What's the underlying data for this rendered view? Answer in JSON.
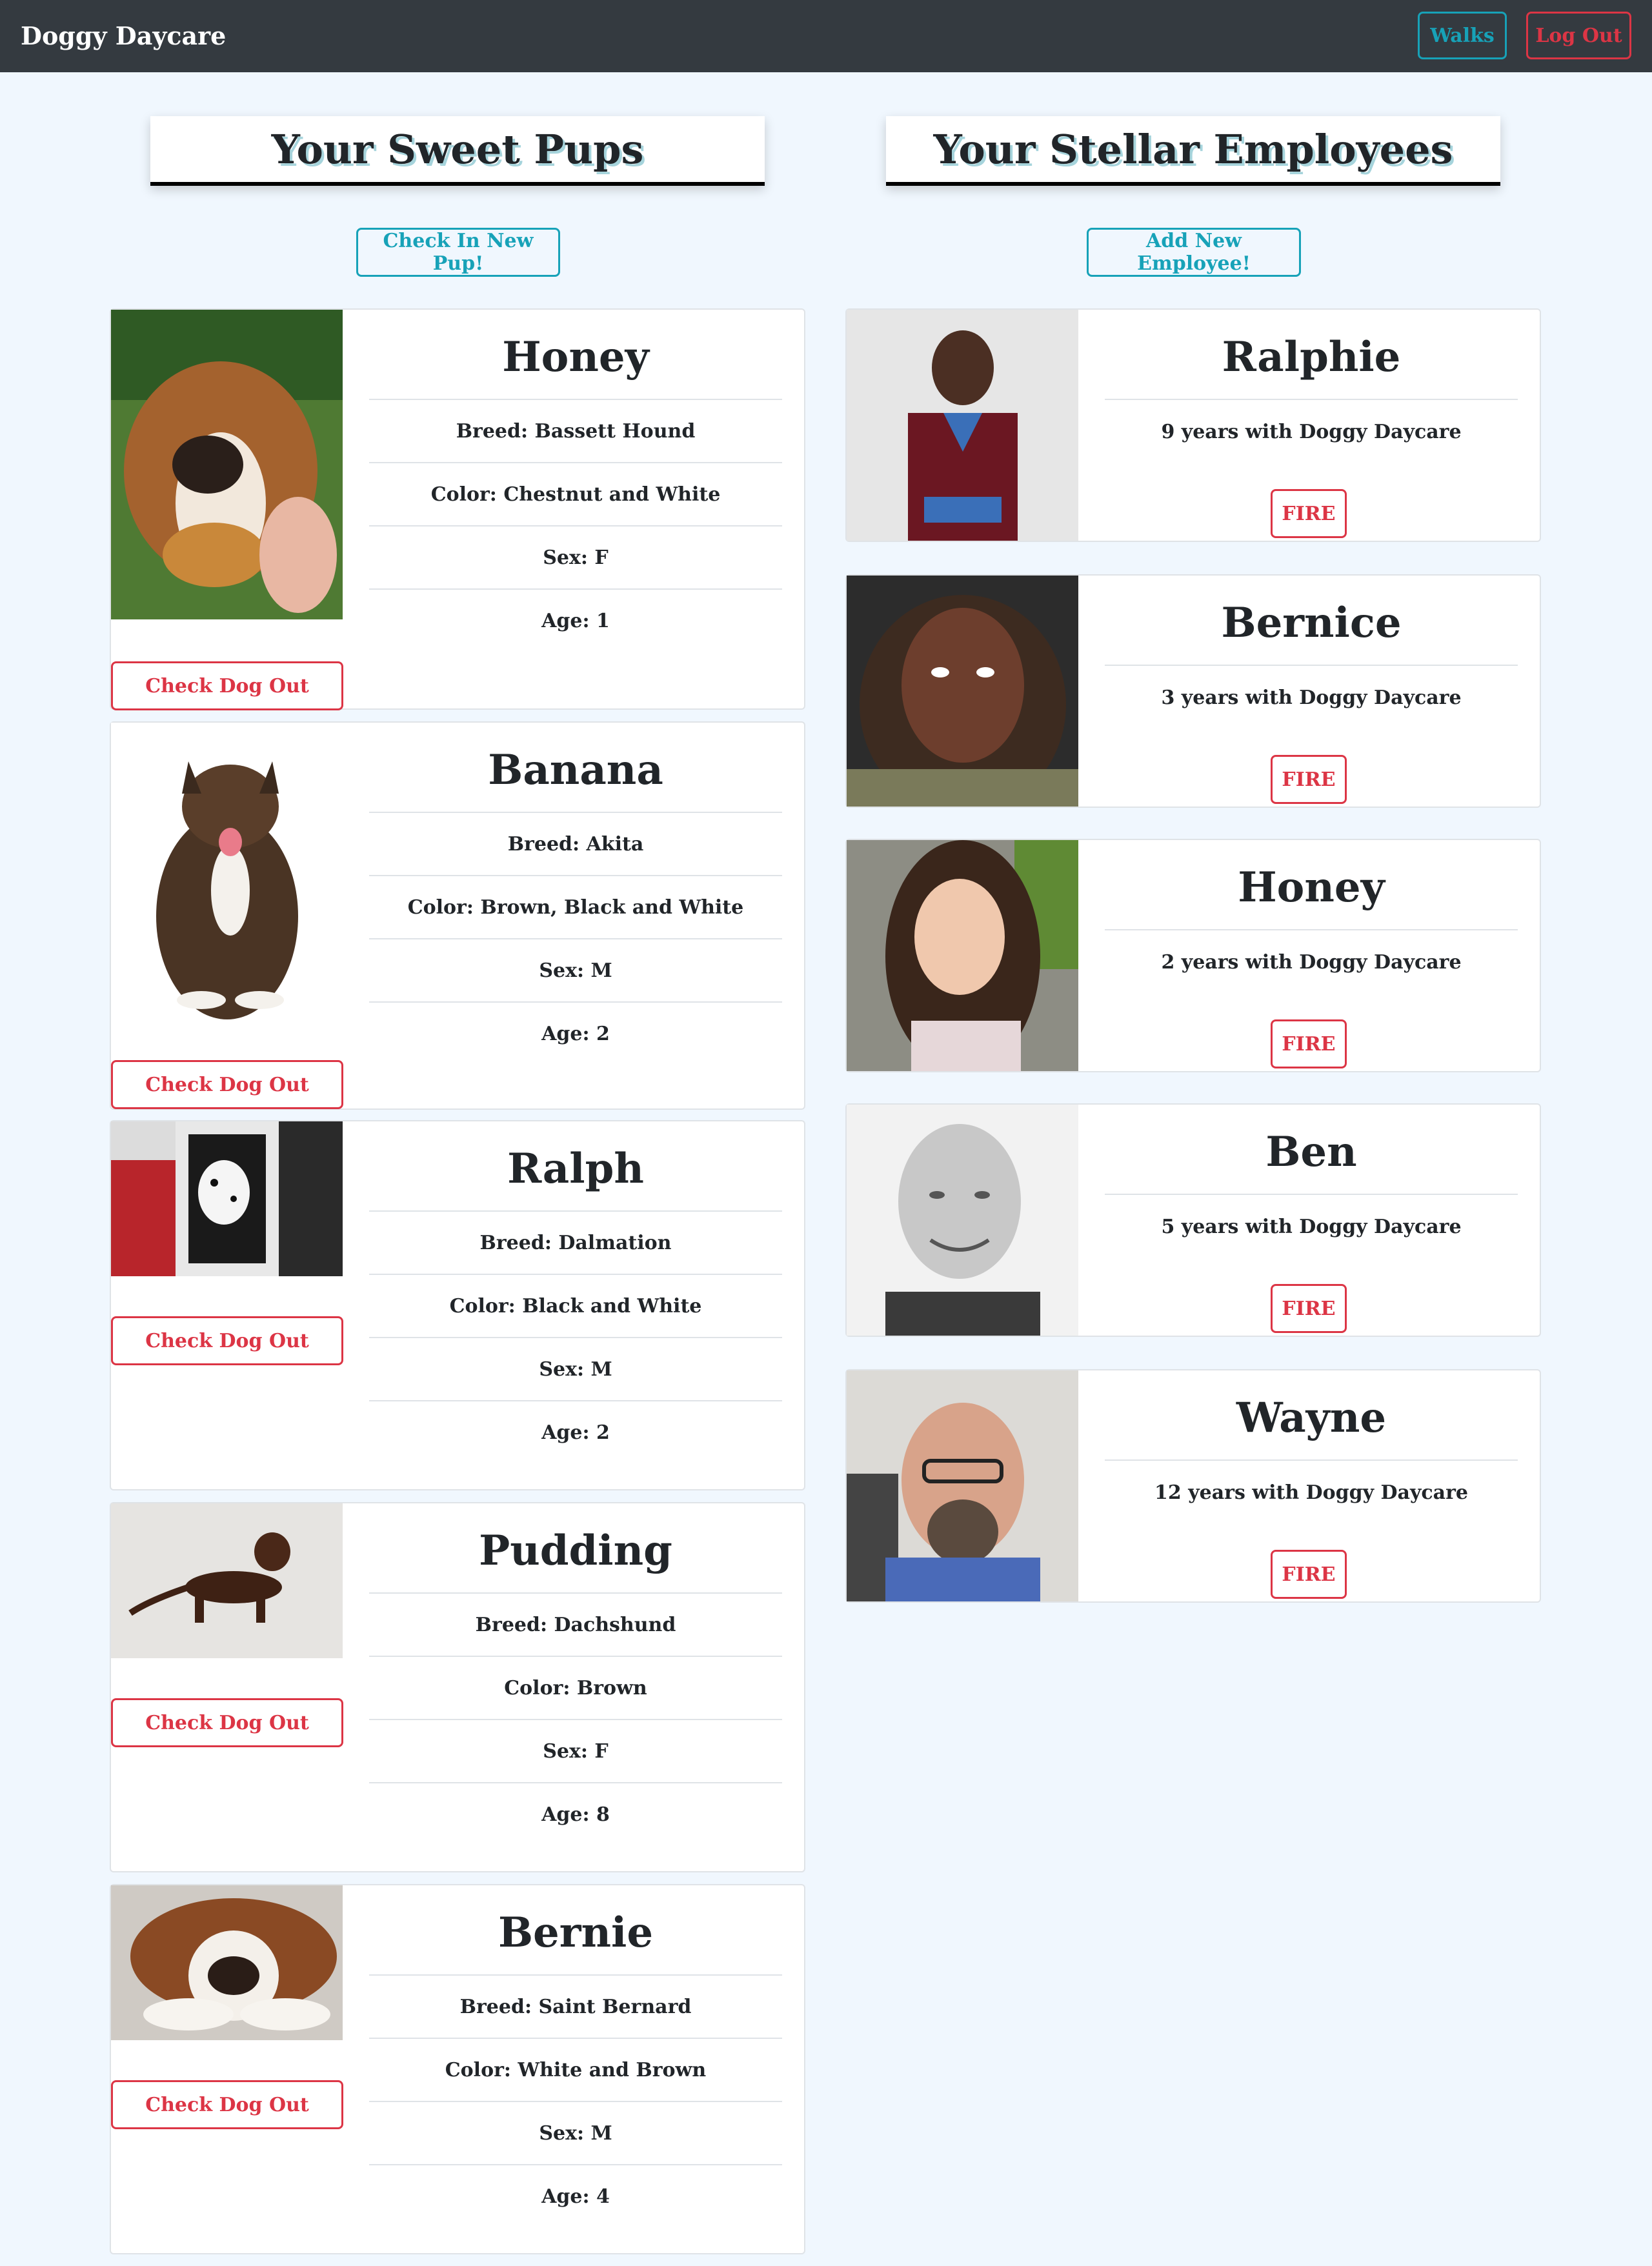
{
  "navbar": {
    "brand": "Doggy Daycare",
    "walks_label": "Walks",
    "logout_label": "Log Out"
  },
  "dogs_section": {
    "title": "Your Sweet Pups",
    "add_label": "Check In New Pup!"
  },
  "employees_section": {
    "title": "Your Stellar Employees",
    "add_label": "Add New Employee!"
  },
  "dogs": [
    {
      "name": "Honey",
      "breed": "Breed: Bassett Hound",
      "color": "Color: Chestnut and White",
      "sex": "Sex: F",
      "age": "Age: 1",
      "checkout_label": "Check Dog Out"
    },
    {
      "name": "Banana",
      "breed": "Breed: Akita",
      "color": "Color: Brown, Black and White",
      "sex": "Sex: M",
      "age": "Age: 2",
      "checkout_label": "Check Dog Out"
    },
    {
      "name": "Ralph",
      "breed": "Breed: Dalmation",
      "color": "Color: Black and White",
      "sex": "Sex: M",
      "age": "Age: 2",
      "checkout_label": "Check Dog Out"
    },
    {
      "name": "Pudding",
      "breed": "Breed: Dachshund",
      "color": "Color: Brown",
      "sex": "Sex: F",
      "age": "Age: 8",
      "checkout_label": "Check Dog Out"
    },
    {
      "name": "Bernie",
      "breed": "Breed: Saint Bernard",
      "color": "Color: White and Brown",
      "sex": "Sex: M",
      "age": "Age: 4",
      "checkout_label": "Check Dog Out"
    }
  ],
  "employees": [
    {
      "name": "Ralphie",
      "tenure": "9 years with Doggy Daycare",
      "fire_label": "FIRE"
    },
    {
      "name": "Bernice",
      "tenure": "3 years with Doggy Daycare",
      "fire_label": "FIRE"
    },
    {
      "name": "Honey",
      "tenure": "2 years with Doggy Daycare",
      "fire_label": "FIRE"
    },
    {
      "name": "Ben",
      "tenure": "5 years with Doggy Daycare",
      "fire_label": "FIRE"
    },
    {
      "name": "Wayne",
      "tenure": "12 years with Doggy Daycare",
      "fire_label": "FIRE"
    }
  ],
  "colors": {
    "navbar_bg": "#343a40",
    "page_bg": "#f0f7fe",
    "info_accent": "#17a2b8",
    "danger_accent": "#dc3545"
  }
}
